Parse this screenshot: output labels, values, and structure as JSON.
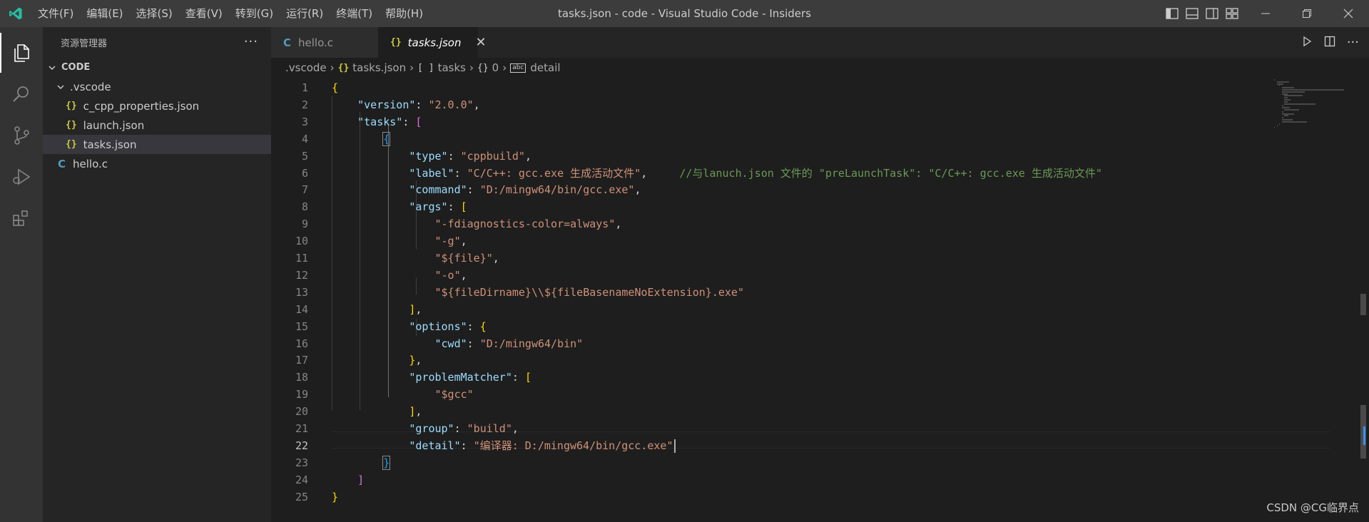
{
  "window": {
    "title": "tasks.json - code - Visual Studio Code - Insiders"
  },
  "menu": [
    "文件(F)",
    "编辑(E)",
    "选择(S)",
    "查看(V)",
    "转到(G)",
    "运行(R)",
    "终端(T)",
    "帮助(H)"
  ],
  "sidebar": {
    "title": "资源管理器",
    "more": "···",
    "root": "CODE",
    "items": [
      {
        "label": ".vscode",
        "type": "folder"
      },
      {
        "label": "c_cpp_properties.json",
        "type": "json"
      },
      {
        "label": "launch.json",
        "type": "json"
      },
      {
        "label": "tasks.json",
        "type": "json",
        "selected": true
      },
      {
        "label": "hello.c",
        "type": "c"
      }
    ]
  },
  "tabs": [
    {
      "label": "hello.c",
      "icon": "C",
      "active": false
    },
    {
      "label": "tasks.json",
      "icon": "{}",
      "active": true,
      "close": "✕"
    }
  ],
  "breadcrumb": {
    "folder": ".vscode",
    "file": "tasks.json",
    "array": "tasks",
    "index": "0",
    "property": "detail",
    "icons": {
      "file": "{}",
      "array": "[ ]",
      "object": "{}",
      "string": "abc"
    }
  },
  "editor": {
    "current_line": 22,
    "lines": [
      {
        "n": "1",
        "text": "{"
      },
      {
        "n": "2",
        "text": "    \"version\": \"2.0.0\","
      },
      {
        "n": "3",
        "text": "    \"tasks\": ["
      },
      {
        "n": "4",
        "text": "        {"
      },
      {
        "n": "5",
        "text": "            \"type\": \"cppbuild\","
      },
      {
        "n": "6",
        "text": "            \"label\": \"C/C++: gcc.exe 生成活动文件\",     //与lanuch.json 文件的 \"preLaunchTask\": \"C/C++: gcc.exe 生成活动文件\""
      },
      {
        "n": "7",
        "text": "            \"command\": \"D:/mingw64/bin/gcc.exe\","
      },
      {
        "n": "8",
        "text": "            \"args\": ["
      },
      {
        "n": "9",
        "text": "                \"-fdiagnostics-color=always\","
      },
      {
        "n": "10",
        "text": "                \"-g\","
      },
      {
        "n": "11",
        "text": "                \"${file}\","
      },
      {
        "n": "12",
        "text": "                \"-o\","
      },
      {
        "n": "13",
        "text": "                \"${fileDirname}\\\\${fileBasenameNoExtension}.exe\""
      },
      {
        "n": "14",
        "text": "            ],"
      },
      {
        "n": "15",
        "text": "            \"options\": {"
      },
      {
        "n": "16",
        "text": "                \"cwd\": \"D:/mingw64/bin\""
      },
      {
        "n": "17",
        "text": "            },"
      },
      {
        "n": "18",
        "text": "            \"problemMatcher\": ["
      },
      {
        "n": "19",
        "text": "                \"$gcc\""
      },
      {
        "n": "20",
        "text": "            ],"
      },
      {
        "n": "21",
        "text": "            \"group\": \"build\","
      },
      {
        "n": "22",
        "text": "            \"detail\": \"编译器: D:/mingw64/bin/gcc.exe\""
      },
      {
        "n": "23",
        "text": "        }"
      },
      {
        "n": "24",
        "text": "    ]"
      },
      {
        "n": "25",
        "text": "}"
      }
    ]
  },
  "colors": {
    "key": "#9cdcfe",
    "string": "#ce9178",
    "comment": "#6a9955",
    "bracket_level1": "#ffd700",
    "bracket_level2": "#da70d6",
    "bracket_level3": "#179fff",
    "accent": "#3794ff"
  },
  "watermark": "CSDN @CG临界点"
}
